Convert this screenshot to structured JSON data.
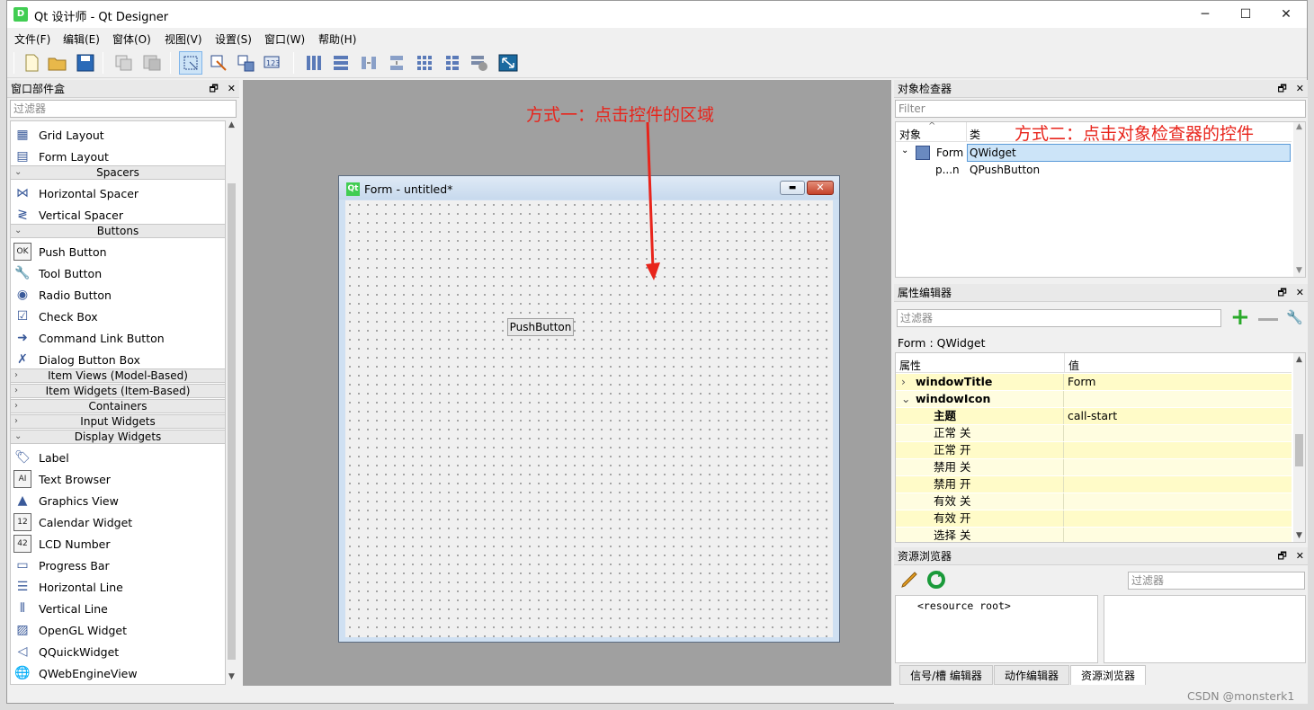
{
  "window": {
    "title": "Qt 设计师 - Qt Designer",
    "icon": "D",
    "minimize": "─",
    "maximize": "☐",
    "close": "✕"
  },
  "menu": [
    "文件(F)",
    "编辑(E)",
    "窗体(O)",
    "视图(V)",
    "设置(S)",
    "窗口(W)",
    "帮助(H)"
  ],
  "toolbar": {
    "icons": [
      "new-file-icon",
      "open-folder-icon",
      "save-icon",
      "copy-icon",
      "paste-icon",
      "edit-widgets-icon",
      "edit-signals-icon",
      "edit-buddies-icon",
      "edit-tab-order-icon",
      "layout-horizontal-icon",
      "layout-vertical-icon",
      "layout-horizontal-splitter-icon",
      "layout-vertical-splitter-icon",
      "layout-grid-icon",
      "layout-form-icon",
      "break-layout-icon",
      "adjust-size-icon"
    ]
  },
  "widget_box": {
    "title": "窗口部件盒",
    "filter_placeholder": "过滤器",
    "float": "🗗",
    "close": "✕",
    "items": [
      {
        "type": "item",
        "label": "Grid Layout",
        "icon": "grid-layout-icon",
        "glyph": "▦"
      },
      {
        "type": "item",
        "label": "Form Layout",
        "icon": "form-layout-icon",
        "glyph": "▤"
      },
      {
        "type": "cat",
        "label": "Spacers",
        "open": true
      },
      {
        "type": "item",
        "label": "Horizontal Spacer",
        "icon": "horizontal-spacer-icon",
        "glyph": "⋈"
      },
      {
        "type": "item",
        "label": "Vertical Spacer",
        "icon": "vertical-spacer-icon",
        "glyph": "≷"
      },
      {
        "type": "cat",
        "label": "Buttons",
        "open": true
      },
      {
        "type": "item",
        "label": "Push Button",
        "icon": "push-button-icon",
        "glyph": "OK"
      },
      {
        "type": "item",
        "label": "Tool Button",
        "icon": "tool-button-icon",
        "glyph": "🔧"
      },
      {
        "type": "item",
        "label": "Radio Button",
        "icon": "radio-button-icon",
        "glyph": "◉"
      },
      {
        "type": "item",
        "label": "Check Box",
        "icon": "check-box-icon",
        "glyph": "☑"
      },
      {
        "type": "item",
        "label": "Command Link Button",
        "icon": "command-link-icon",
        "glyph": "➜"
      },
      {
        "type": "item",
        "label": "Dialog Button Box",
        "icon": "dialog-button-box-icon",
        "glyph": "✗"
      },
      {
        "type": "cat",
        "label": "Item Views (Model-Based)",
        "open": false
      },
      {
        "type": "cat",
        "label": "Item Widgets (Item-Based)",
        "open": false
      },
      {
        "type": "cat",
        "label": "Containers",
        "open": false
      },
      {
        "type": "cat",
        "label": "Input Widgets",
        "open": false
      },
      {
        "type": "cat",
        "label": "Display Widgets",
        "open": true
      },
      {
        "type": "item",
        "label": "Label",
        "icon": "label-icon",
        "glyph": "🏷"
      },
      {
        "type": "item",
        "label": "Text Browser",
        "icon": "text-browser-icon",
        "glyph": "AI"
      },
      {
        "type": "item",
        "label": "Graphics View",
        "icon": "graphics-view-icon",
        "glyph": "▲"
      },
      {
        "type": "item",
        "label": "Calendar Widget",
        "icon": "calendar-icon",
        "glyph": "12"
      },
      {
        "type": "item",
        "label": "LCD Number",
        "icon": "lcd-number-icon",
        "glyph": "42"
      },
      {
        "type": "item",
        "label": "Progress Bar",
        "icon": "progress-bar-icon",
        "glyph": "▭"
      },
      {
        "type": "item",
        "label": "Horizontal Line",
        "icon": "horizontal-line-icon",
        "glyph": "☰"
      },
      {
        "type": "item",
        "label": "Vertical Line",
        "icon": "vertical-line-icon",
        "glyph": "⦀"
      },
      {
        "type": "item",
        "label": "OpenGL Widget",
        "icon": "opengl-icon",
        "glyph": "▨"
      },
      {
        "type": "item",
        "label": "QQuickWidget",
        "icon": "quick-widget-icon",
        "glyph": "◁"
      },
      {
        "type": "item",
        "label": "QWebEngineView",
        "icon": "web-engine-icon",
        "glyph": "🌐"
      }
    ]
  },
  "form": {
    "title": "Form - untitled*",
    "push_button": "PushButton"
  },
  "annotations": {
    "first": "方式一：点击控件的区域",
    "second": "方式二：点击对象检查器的控件"
  },
  "object_inspector": {
    "title": "对象检查器",
    "filter_placeholder": "Filter",
    "col_object": "对象",
    "col_class": "类",
    "rows": [
      {
        "object": "Form",
        "class": "QWidget"
      },
      {
        "object": "p...n",
        "class": "QPushButton"
      }
    ]
  },
  "property_editor": {
    "title": "属性编辑器",
    "filter_placeholder": "过滤器",
    "context": "Form : QWidget",
    "col_property": "属性",
    "col_value": "值",
    "rows": [
      {
        "name": "windowTitle",
        "value": "Form",
        "level": 0,
        "bold": true,
        "arrow": "›"
      },
      {
        "name": "windowIcon",
        "value": "",
        "level": 0,
        "bold": true,
        "arrow": "⌄"
      },
      {
        "name": "主题",
        "value": "call-start",
        "level": 1,
        "bold": true,
        "arrow": ""
      },
      {
        "name": "正常 关",
        "value": "",
        "level": 1,
        "bold": false,
        "arrow": ""
      },
      {
        "name": "正常 开",
        "value": "",
        "level": 1,
        "bold": false,
        "arrow": ""
      },
      {
        "name": "禁用 关",
        "value": "",
        "level": 1,
        "bold": false,
        "arrow": ""
      },
      {
        "name": "禁用 开",
        "value": "",
        "level": 1,
        "bold": false,
        "arrow": ""
      },
      {
        "name": "有效 关",
        "value": "",
        "level": 1,
        "bold": false,
        "arrow": ""
      },
      {
        "name": "有效 开",
        "value": "",
        "level": 1,
        "bold": false,
        "arrow": ""
      },
      {
        "name": "选择 关",
        "value": "",
        "level": 1,
        "bold": false,
        "arrow": ""
      }
    ]
  },
  "resource_browser": {
    "title": "资源浏览器",
    "filter_placeholder": "过滤器",
    "root": "<resource root>",
    "tabs": [
      "信号/槽 编辑器",
      "动作编辑器",
      "资源浏览器"
    ]
  },
  "watermark": "CSDN @monsterk1"
}
